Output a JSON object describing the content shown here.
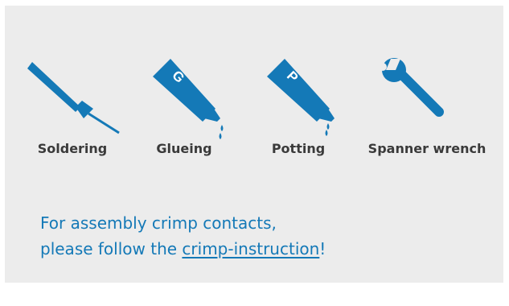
{
  "colors": {
    "icon": "#1479b7",
    "label": "#3a3a3a",
    "panel": "#ececec",
    "note": "#1479b7"
  },
  "tools": [
    {
      "id": "soldering",
      "icon": "soldering-iron-icon",
      "label": "Soldering"
    },
    {
      "id": "glueing",
      "icon": "glue-tube-icon",
      "tube_letter": "G",
      "label": "Glueing"
    },
    {
      "id": "potting",
      "icon": "potting-tube-icon",
      "tube_letter": "P",
      "label": "Potting"
    },
    {
      "id": "spanner",
      "icon": "spanner-wrench-icon",
      "label": "Spanner wrench"
    }
  ],
  "note": {
    "line1": "For assembly crimp contacts,",
    "line2_prefix": "please follow the ",
    "link_text": "crimp-instruction",
    "line2_suffix": "!"
  }
}
